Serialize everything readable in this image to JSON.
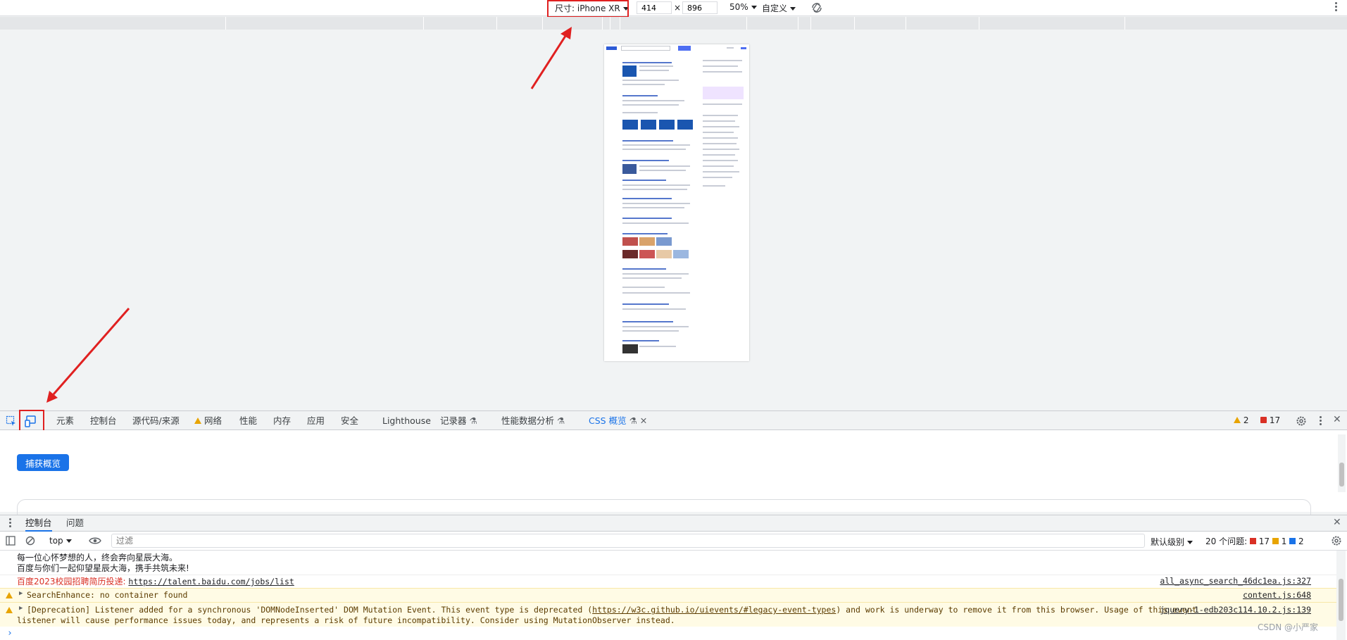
{
  "device_toolbar": {
    "dimensions_label": "尺寸: iPhone XR",
    "width": "414",
    "times": "×",
    "height": "896",
    "zoom": "50%",
    "throttle": "自定义"
  },
  "tabs": {
    "elements": "元素",
    "console": "控制台",
    "sources": "源代码/来源",
    "network": "网络",
    "performance": "性能",
    "memory": "内存",
    "application": "应用",
    "security": "安全",
    "lighthouse": "Lighthouse",
    "recorder": "记录器",
    "perf_insights": "性能数据分析",
    "css_overview": "CSS 概览"
  },
  "counts": {
    "warnings": "2",
    "errors": "17"
  },
  "css_overview": {
    "capture_button": "捕获概览"
  },
  "drawer": {
    "console_tab": "控制台",
    "issues_tab": "问题"
  },
  "console_toolbar": {
    "context": "top",
    "filter_placeholder": "过滤",
    "levels": "默认级别",
    "issues_label": "20 个问题:",
    "issues_errors": "17",
    "issues_warnings": "1",
    "issues_info": "2"
  },
  "console": {
    "line1": "每一位心怀梦想的人，终会奔向星辰大海。",
    "line2": "百度与你们一起仰望星辰大海，携手共筑未来!",
    "line3_prefix": "百度2023校园招聘简历投递: ",
    "line3_link": "https://talent.baidu.com/jobs/list",
    "line3_src": "all_async_search_46dc1ea.js:327",
    "warn1": "SearchEnhance: no container found",
    "warn1_src": "content.js:648",
    "warn2_a": "[Deprecation] Listener added for a synchronous 'DOMNodeInserted' DOM Mutation Event. This event type is deprecated (",
    "warn2_link": "https://w3c.github.io/uievents/#legacy-event-types",
    "warn2_b": ") and work is underway to remove it from this browser. Usage of this event",
    "warn2_c": "listener will cause performance issues today, and represents a risk of future incompatibility. Consider using MutationObserver instead.",
    "warn2_src": "jquery-1-edb203c114.10.2.js:139",
    "prompt": "›"
  },
  "watermark": "CSDN @小严家",
  "colors": {
    "accent": "#1a73e8",
    "annotation_red": "#e02020",
    "warning": "#e8a400",
    "error": "#d93025"
  }
}
